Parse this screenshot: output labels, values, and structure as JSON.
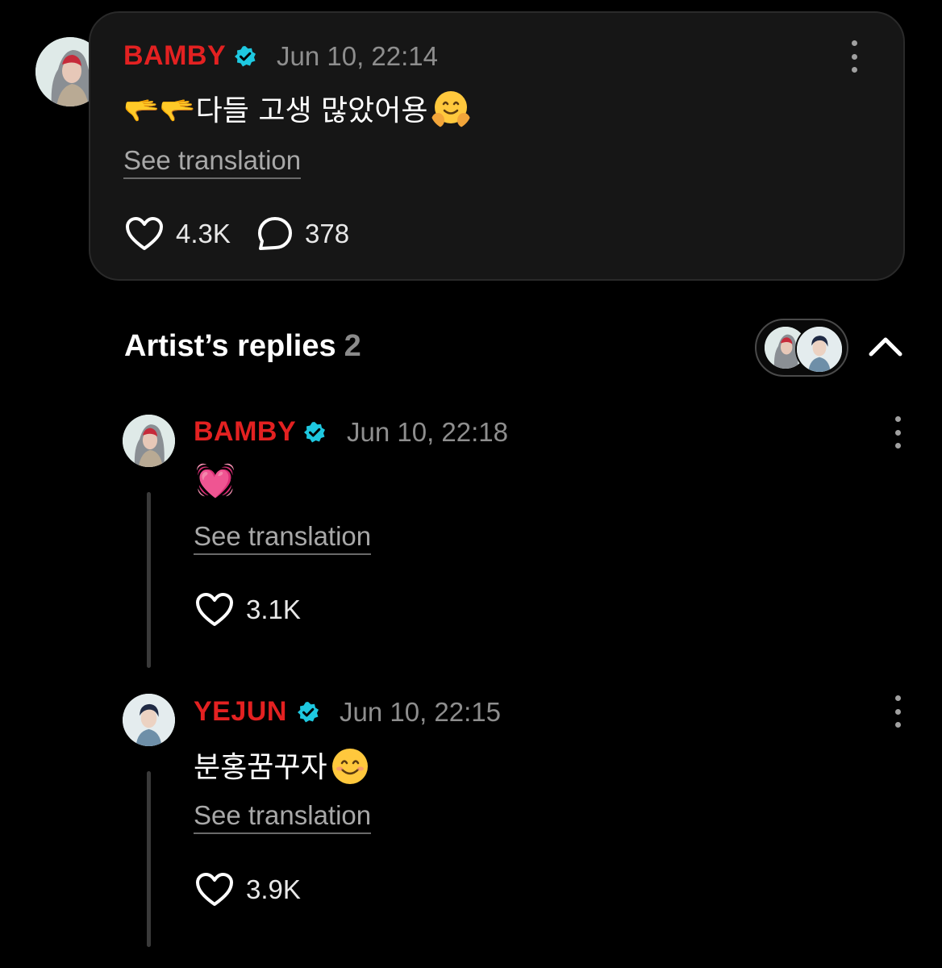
{
  "post": {
    "author": "BAMBY",
    "time": "Jun 10, 22:14",
    "text": "🫳🫳다들 고생 많았어용",
    "emoji_name": "hugging-face",
    "translate_label": "See translation",
    "likes": "4.3K",
    "comments": "378"
  },
  "replies_section": {
    "title": "Artist’s replies",
    "count": "2"
  },
  "replies": [
    {
      "author": "BAMBY",
      "time": "Jun 10, 22:18",
      "text": "💓",
      "translate_label": "See translation",
      "likes": "3.1K"
    },
    {
      "author": "YEJUN",
      "time": "Jun 10, 22:15",
      "text": "분홍꿈꾸자",
      "emoji_name": "smiling-face",
      "translate_label": "See translation",
      "likes": "3.9K"
    }
  ],
  "colors": {
    "name_red": "#e32121",
    "verified_cyan": "#1ec8e0",
    "background": "#000000",
    "card": "#161616"
  }
}
